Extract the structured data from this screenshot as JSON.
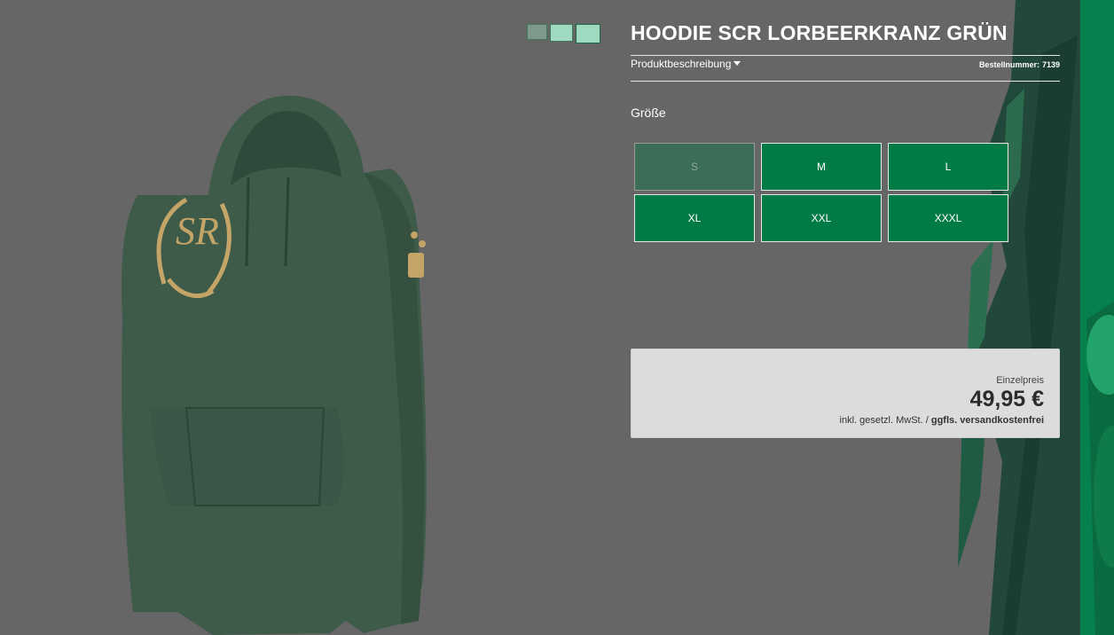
{
  "product": {
    "title": "HOODIE SCR LORBEERKRANZ GRÜN",
    "description_toggle": "Produktbeschreibung",
    "order_number_label": "Bestellnummer:",
    "order_number": "7139"
  },
  "thumbnails": [
    {
      "name": "thumbnail-1"
    },
    {
      "name": "thumbnail-2"
    },
    {
      "name": "thumbnail-3"
    }
  ],
  "size_section": {
    "label": "Größe",
    "options": [
      {
        "label": "S",
        "available": false
      },
      {
        "label": "M",
        "available": true
      },
      {
        "label": "L",
        "available": true
      },
      {
        "label": "XL",
        "available": true
      },
      {
        "label": "XXL",
        "available": true
      },
      {
        "label": "XXXL",
        "available": true
      }
    ]
  },
  "price_box": {
    "label": "Einzelpreis",
    "price": "49,95 €",
    "tax_text": "inkl. gesetzl. MwSt. /",
    "shipping_text": "ggfls. versandkostenfrei"
  },
  "colors": {
    "background": "#666666",
    "accent_green": "#017b46",
    "deco_dark_green": "#1e3b2e"
  },
  "icons": {
    "dropdown": "caret-down-icon"
  }
}
